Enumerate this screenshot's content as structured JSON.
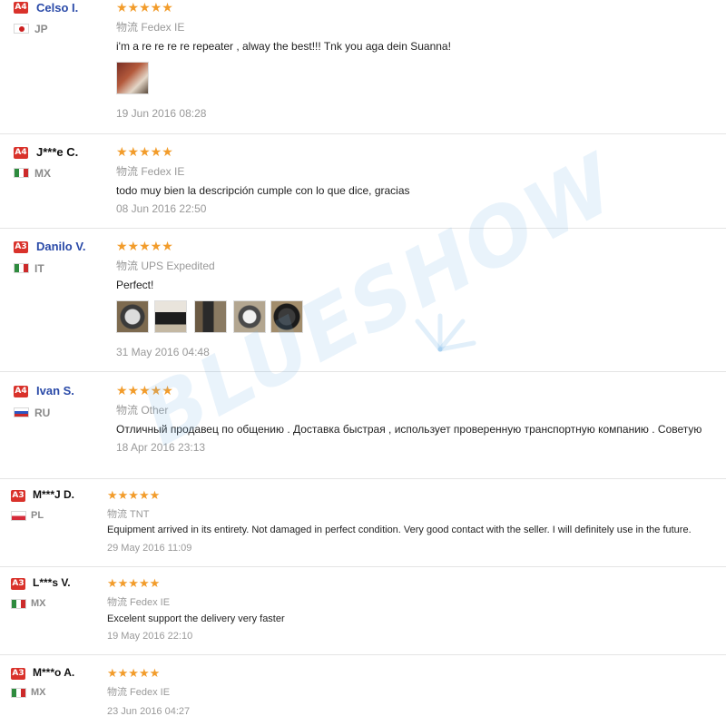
{
  "reviews": [
    {
      "badge": "A4",
      "name": "Celso I.",
      "name_link": true,
      "country": "JP",
      "flag": "jp",
      "stars": "★★★★★",
      "shipping": "物流 Fedex IE",
      "feedback": "i'm a re re re re repeater , alway the best!!! Tnk you aga dein Suanna!",
      "photos": [
        "photo-1"
      ],
      "date": "19 Jun 2016 08:28"
    },
    {
      "badge": "A4",
      "name": "J***e C.",
      "name_link": false,
      "country": "MX",
      "flag": "mx",
      "stars": "★★★★★",
      "shipping": "物流 Fedex IE",
      "feedback": "todo muy bien la descripción cumple con lo que dice, gracias",
      "photos": [],
      "date": "08 Jun 2016 22:50"
    },
    {
      "badge": "A3",
      "name": "Danilo V.",
      "name_link": true,
      "country": "IT",
      "flag": "it",
      "stars": "★★★★★",
      "shipping": "物流 UPS Expedited",
      "feedback": "Perfect!",
      "photos": [
        "photo-1",
        "photo-2",
        "photo-3",
        "photo-4",
        "photo-5"
      ],
      "date": "31 May 2016 04:48"
    },
    {
      "badge": "A4",
      "name": "Ivan S.",
      "name_link": true,
      "country": "RU",
      "flag": "ru",
      "stars": "★★★★★",
      "shipping": "物流 Other",
      "feedback": "Отличный продавец по общению . Доставка быстрая , использует проверенную транспортную компанию . Советую",
      "photos": [],
      "date": "18 Apr 2016 23:13"
    },
    {
      "badge": "A3",
      "name": "M***J D.",
      "name_link": false,
      "country": "PL",
      "flag": "pl",
      "stars": "★★★★★",
      "shipping": "物流 TNT",
      "feedback": "Equipment arrived in its entirety. Not damaged in perfect condition. Very good contact with the seller. I will definitely use in the future.",
      "photos": [],
      "date": "29 May 2016 11:09"
    },
    {
      "badge": "A3",
      "name": "L***s V.",
      "name_link": false,
      "country": "MX",
      "flag": "mx",
      "stars": "★★★★★",
      "shipping": "物流 Fedex IE",
      "feedback": "Excelent support the delivery very faster",
      "photos": [],
      "date": "19 May 2016 22:10"
    },
    {
      "badge": "A3",
      "name": "M***o A.",
      "name_link": false,
      "country": "MX",
      "flag": "mx",
      "stars": "★★★★★",
      "shipping": "物流 Fedex IE",
      "feedback": "",
      "photos": [],
      "date": "23 Jun 2016 04:27"
    }
  ],
  "watermark": {
    "text": "BLUESHOW",
    "color": "#78b4e6"
  },
  "colors": {
    "badge": "#d9322b",
    "star": "#f29c2b",
    "link": "#2a4aa8",
    "muted": "#999999",
    "divider": "#e4e4e4"
  }
}
